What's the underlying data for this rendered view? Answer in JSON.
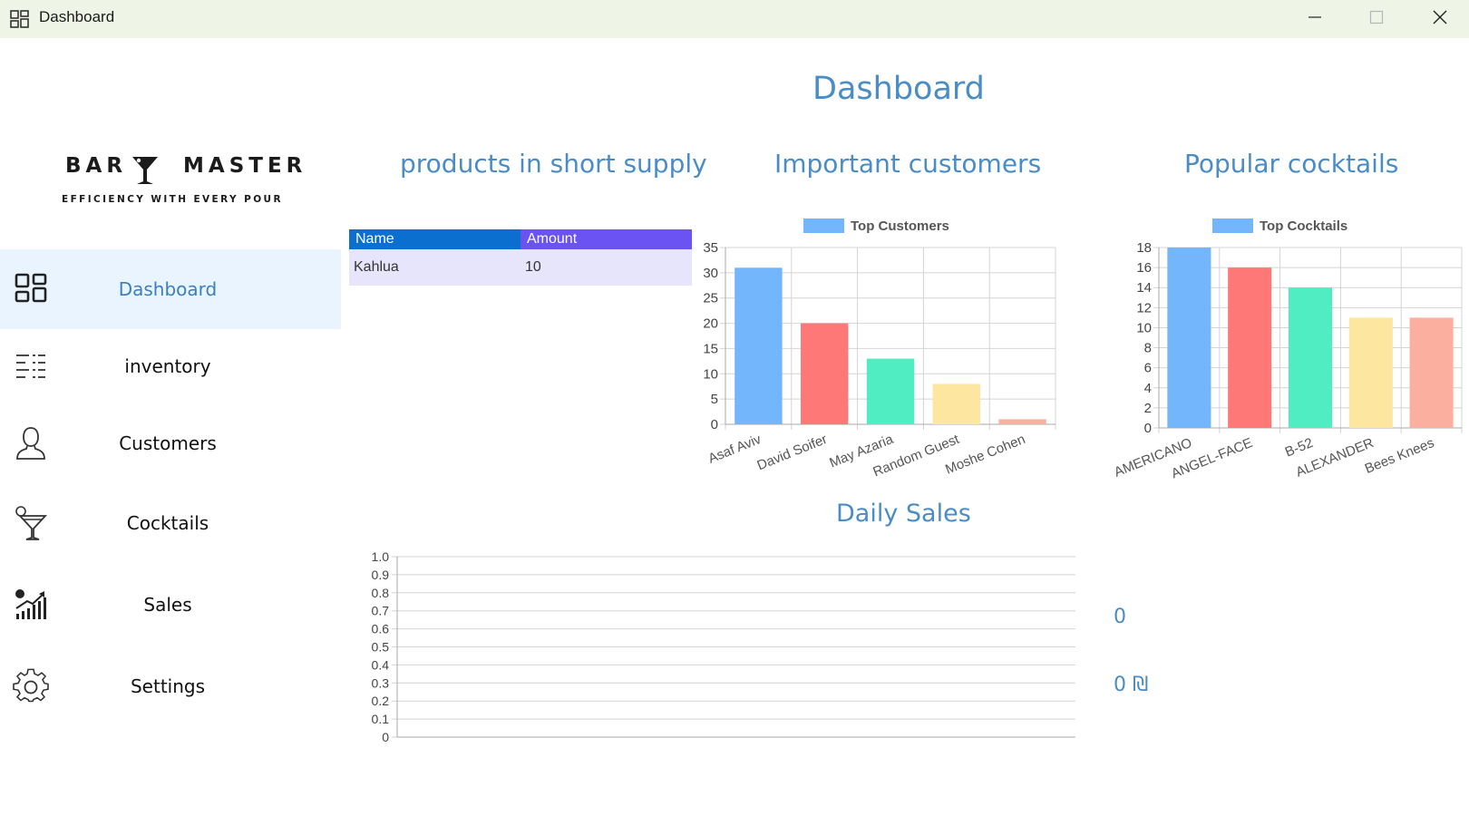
{
  "window": {
    "title": "Dashboard",
    "icon": "dashboard-icon",
    "controls": [
      "minimize-icon",
      "maximize-icon",
      "close-icon"
    ]
  },
  "logo": {
    "word_left": "BAR",
    "word_right": "MASTER",
    "tagline": "EFFICIENCY WITH EVERY POUR"
  },
  "sidebar": {
    "items": [
      {
        "label": "Dashboard",
        "icon": "dashboard-icon",
        "active": true
      },
      {
        "label": "inventory",
        "icon": "inventory-list-icon",
        "active": false
      },
      {
        "label": "Customers",
        "icon": "person-icon",
        "active": false
      },
      {
        "label": "Cocktails",
        "icon": "cocktail-glass-icon",
        "active": false
      },
      {
        "label": "Sales",
        "icon": "sales-chart-icon",
        "active": false
      },
      {
        "label": "Settings",
        "icon": "gear-icon",
        "active": false
      }
    ]
  },
  "main": {
    "title": "Dashboard",
    "short_supply": {
      "heading": "products in short supply",
      "columns": [
        "Name",
        "Amount"
      ],
      "rows": [
        [
          "Kahlua",
          "10"
        ]
      ]
    },
    "customers_heading": "Important customers",
    "cocktails_heading": "Popular cocktails",
    "daily_heading": "Daily Sales",
    "stats": {
      "count": "0",
      "revenue": "0 ₪"
    }
  },
  "colors": {
    "accent": "#4a8cc6",
    "nav_active_bg": "#eaf4ff",
    "bar_palette": [
      "#74b6fb",
      "#ff7878",
      "#50edc3",
      "#fde6a0",
      "#fbb09f"
    ]
  },
  "chart_data": [
    {
      "type": "bar",
      "legend": "Top Customers",
      "legend_position": "top",
      "categories": [
        "Asaf Aviv",
        "David Soifer",
        "May Azaria",
        "Random Guest",
        "Moshe Cohen"
      ],
      "values": [
        31,
        20,
        13,
        8,
        1
      ],
      "ylim": [
        0,
        35
      ],
      "yticks": [
        0,
        5,
        10,
        15,
        20,
        25,
        30,
        35
      ],
      "grid": true
    },
    {
      "type": "bar",
      "legend": "Top Cocktails",
      "legend_position": "top",
      "categories": [
        "AMERICANO",
        "ANGEL-FACE",
        "B-52",
        "ALEXANDER",
        "Bees Knees"
      ],
      "values": [
        18,
        16,
        14,
        11,
        11
      ],
      "ylim": [
        0,
        18
      ],
      "yticks": [
        0,
        2,
        4,
        6,
        8,
        10,
        12,
        14,
        16,
        18
      ],
      "grid": true
    },
    {
      "type": "line",
      "categories": [],
      "series": [],
      "ylim": [
        0,
        1
      ],
      "yticks": [
        "0",
        "0.1",
        "0.2",
        "0.3",
        "0.4",
        "0.5",
        "0.6",
        "0.7",
        "0.8",
        "0.9",
        "1.0"
      ],
      "grid": true
    }
  ]
}
